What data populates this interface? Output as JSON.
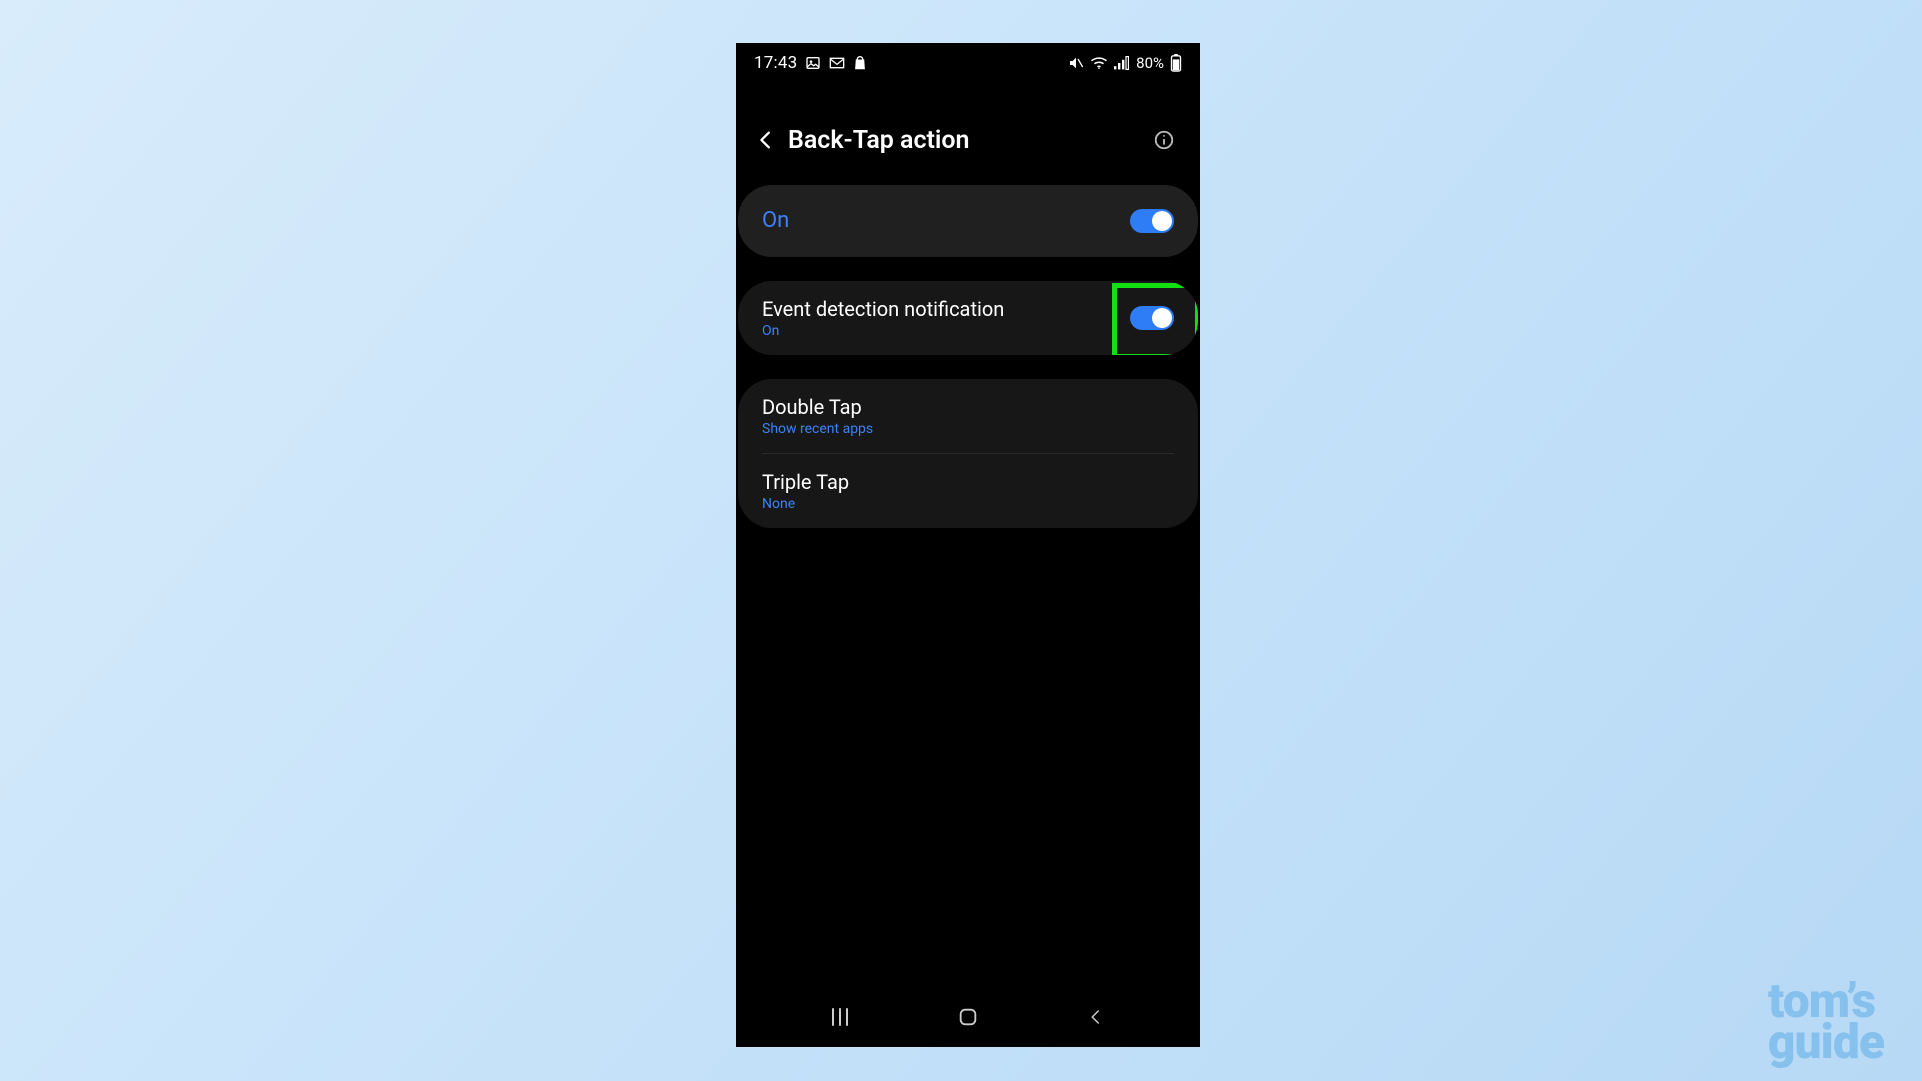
{
  "status_bar": {
    "time": "17:43",
    "battery_pct": "80%"
  },
  "header": {
    "title": "Back-Tap action"
  },
  "master_toggle": {
    "label": "On",
    "enabled": true
  },
  "event_detection": {
    "title": "Event detection notification",
    "sub": "On",
    "enabled": true
  },
  "tap_actions": {
    "double": {
      "title": "Double Tap",
      "sub": "Show recent apps"
    },
    "triple": {
      "title": "Triple Tap",
      "sub": "None"
    }
  },
  "watermark": {
    "line1": "tom’s",
    "line2": "guide"
  }
}
